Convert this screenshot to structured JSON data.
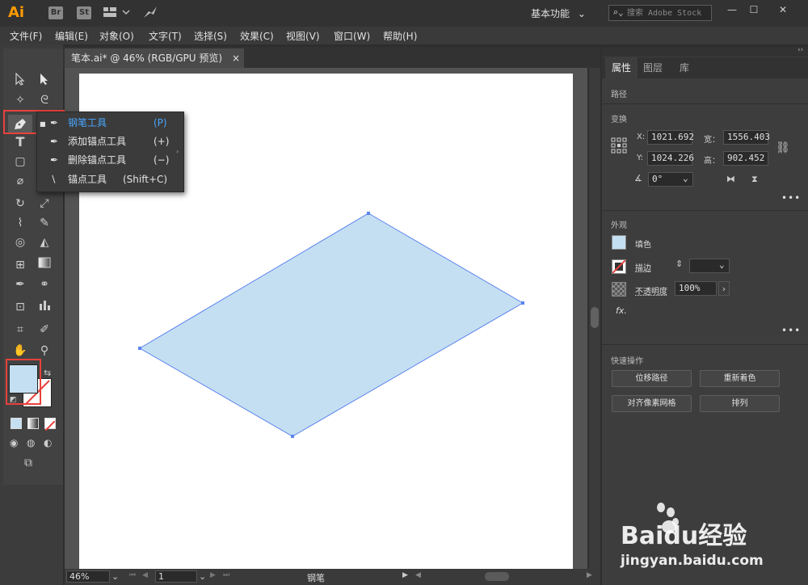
{
  "app": {
    "logo": "Ai",
    "bridge_label": "Br",
    "stock_label": "St",
    "workspace_label": "基本功能",
    "search_placeholder": "搜索 Adobe Stock"
  },
  "menu": [
    "文件(F)",
    "编辑(E)",
    "对象(O)",
    "文字(T)",
    "选择(S)",
    "效果(C)",
    "视图(V)",
    "窗口(W)",
    "帮助(H)"
  ],
  "document_tab": {
    "title": "笔本.ai* @ 46% (RGB/GPU 预览)",
    "close": "×"
  },
  "flyout": {
    "items": [
      {
        "label": "钢笔工具",
        "shortcut": "(P)",
        "active": true
      },
      {
        "label": "添加锚点工具",
        "shortcut": "(+)",
        "active": false
      },
      {
        "label": "删除锚点工具",
        "shortcut": "(−)",
        "active": false
      },
      {
        "label": "锚点工具",
        "shortcut": "(Shift+C)",
        "active": false
      }
    ]
  },
  "statusbar": {
    "zoom": "46%",
    "artboard_number": "1",
    "tool_name": "钢笔"
  },
  "right_panel": {
    "tabs": [
      "属性",
      "图层",
      "库"
    ],
    "path_label": "路径",
    "transform_label": "变换",
    "x_label": "X:",
    "x_value": "1021.692",
    "y_label": "Y:",
    "y_value": "1024.226",
    "w_label": "宽：",
    "w_value": "1556.403",
    "h_label": "高：",
    "h_value": "902.452",
    "angle_value": "0°",
    "appearance_label": "外观",
    "fill_label": "填色",
    "stroke_label": "描边",
    "opacity_label": "不透明度",
    "opacity_value": "100%",
    "fx_label": "fx.",
    "quick_actions_label": "快速操作",
    "buttons": [
      "位移路径",
      "重新着色",
      "对齐像素网格",
      "排列"
    ]
  },
  "watermark": {
    "brand": "Baidu经验",
    "url": "jingyan.baidu.com"
  },
  "colors": {
    "fill": "#c5dff2",
    "path_stroke": "#5b84f0",
    "highlight_box": "#e8413c",
    "active_text": "#49a7ff",
    "logo": "#ff9a00"
  }
}
